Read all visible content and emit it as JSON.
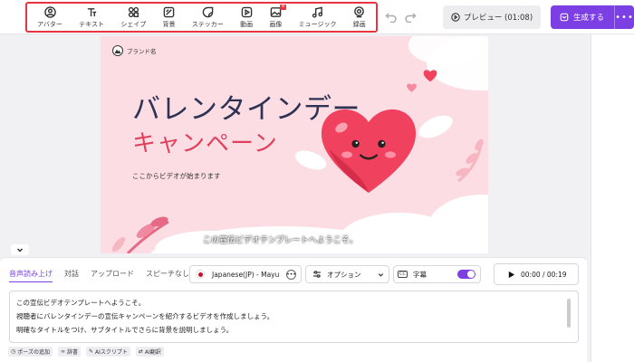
{
  "toolbar": {
    "tools": [
      {
        "label": "アバター",
        "icon": "avatar-icon"
      },
      {
        "label": "テキスト",
        "icon": "text-icon"
      },
      {
        "label": "シェイプ",
        "icon": "shapes-icon"
      },
      {
        "label": "背景",
        "icon": "background-icon"
      },
      {
        "label": "ステッカー",
        "icon": "sticker-icon"
      },
      {
        "label": "動画",
        "icon": "video-icon"
      },
      {
        "label": "画像",
        "icon": "image-icon",
        "badge": "N"
      },
      {
        "label": "ミュージック",
        "icon": "music-icon"
      },
      {
        "label": "録画",
        "icon": "record-icon"
      }
    ],
    "preview_label": "プレビュー (01:08)",
    "generate_label": "生成する",
    "more_label": "•••"
  },
  "canvas": {
    "brand_name": "ブランド名",
    "title_line1": "バレンタインデー",
    "title_line2": "キャンペーン",
    "subtitle": "ここからビデオが始まります",
    "caption": "この宣伝ビデオテンプレートへようこそ。"
  },
  "script_panel": {
    "tabs": [
      "音声読み上げ",
      "対話",
      "アップロード",
      "スピーチなし"
    ],
    "active_tab": "音声読み上げ",
    "voice": "Japanese(JP) - Mayu",
    "options_label": "オプション",
    "subtitles_label": "字幕",
    "subtitles_on": true,
    "playback_time": "00:00 / 00:19",
    "script_lines": [
      "この宣伝ビデオテンプレートへようこそ。",
      "視聴者にバレンタインデーの宣伝キャンペーンを紹介するビデオを作成しましょう。",
      "明確なタイトルをつけ、サブタイトルでさらに背景を説明しましょう。"
    ],
    "footer_chips": [
      {
        "label": "ポーズの追加",
        "icon": "clock-icon"
      },
      {
        "label": "辞書",
        "icon": "link-icon"
      },
      {
        "label": "AIスクリプト",
        "icon": "ai-script-icon"
      },
      {
        "label": "AI翻訳",
        "icon": "translate-icon"
      }
    ]
  },
  "colors": {
    "accent": "#7b3fe4",
    "highlight_border": "#e8343f",
    "canvas_bg": "#fbdde3",
    "title_dark": "#2e3354",
    "title_red": "#e0405b"
  }
}
